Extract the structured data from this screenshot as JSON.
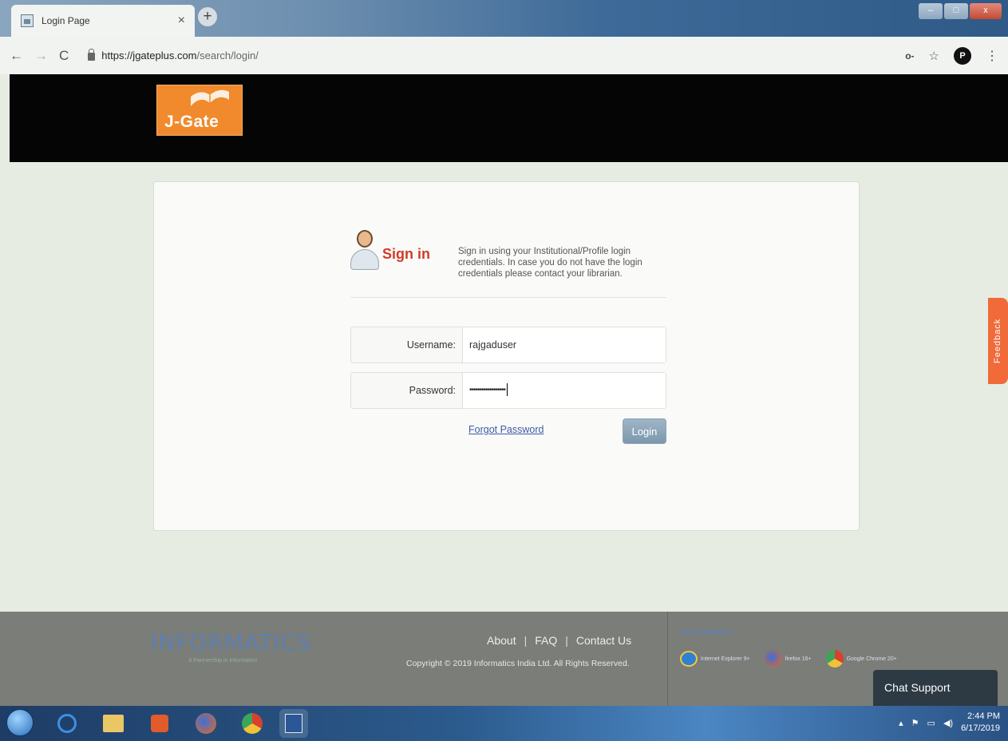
{
  "browser": {
    "tab_title": "Login Page",
    "tab_close": "×",
    "new_tab": "+",
    "url_host": "https://jgateplus.com",
    "url_path": "/search/login/",
    "profile_initial": "P",
    "window_controls": {
      "minimize": "–",
      "maximize": "□",
      "close": "x"
    }
  },
  "site": {
    "logo_text": "J-Gate"
  },
  "login": {
    "title": "Sign in",
    "description": "Sign in using your Institutional/Profile login credentials. In case you do not have the login credentials please contact your librarian.",
    "username_label": "Username:",
    "username_value": "rajgaduser",
    "password_label": "Password:",
    "password_mask": "••••••••••••••••••",
    "forgot_label": "Forgot Password",
    "login_label": "Login"
  },
  "feedback_label": "Feedback",
  "footer": {
    "brand": "INFORMATICS",
    "brand_sub": "A Partnership in Information",
    "links": [
      "About",
      "FAQ",
      "Contact Us"
    ],
    "separator": "|",
    "copyright": "Copyright © 2019   Informatics India Ltd. All Rights Reserved.",
    "best_viewed": "Best viewed in",
    "browsers": [
      {
        "name": "Internet Explorer 9+",
        "icon": "ie-icon"
      },
      {
        "name": "firefox 16+",
        "icon": "firefox-icon"
      },
      {
        "name": "Google Chrome 20+",
        "icon": "chrome-icon"
      }
    ]
  },
  "chat_support_label": "Chat Support",
  "taskbar": {
    "time": "2:44 PM",
    "date": "6/17/2019"
  },
  "colors": {
    "accent_orange": "#f08a2c",
    "signin_red": "#d13a2a",
    "footer_gray": "#7a7d78",
    "link_blue": "#3d59a8"
  }
}
